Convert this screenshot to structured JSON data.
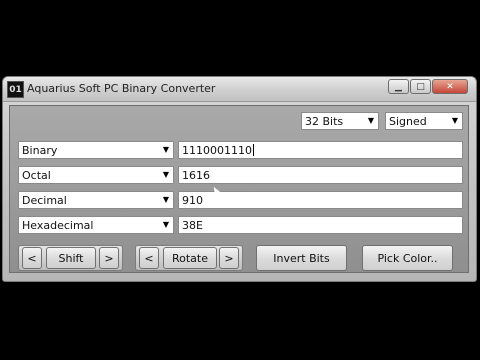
{
  "window": {
    "title": "Aquarius Soft PC Binary Converter",
    "icon_glyph": "01"
  },
  "controls": {
    "bits_label": "32 Bits",
    "sign_label": "Signed"
  },
  "rows": [
    {
      "base_label": "Binary",
      "value": "1110001110"
    },
    {
      "base_label": "Octal",
      "value": "1616"
    },
    {
      "base_label": "Decimal",
      "value": "910"
    },
    {
      "base_label": "Hexadecimal",
      "value": "38E"
    }
  ],
  "buttons": {
    "shift_label": "Shift",
    "rotate_label": "Rotate",
    "invert_label": "Invert Bits",
    "pick_color_label": "Pick Color..",
    "left_arrow": "<",
    "right_arrow": ">"
  }
}
